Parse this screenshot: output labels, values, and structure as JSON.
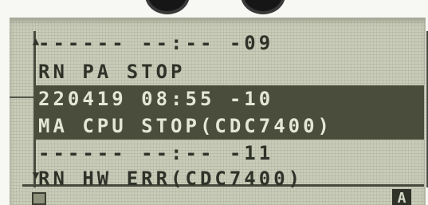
{
  "log": {
    "entries": [
      {
        "line1_date": "------",
        "line1_time": "--:--",
        "line1_code": "-09",
        "message": null
      },
      {
        "line1_date": null,
        "message": "RN PA STOP"
      },
      {
        "line1_date": "220419",
        "line1_time": "08:55",
        "line1_code": "-10",
        "selected": true
      },
      {
        "message": "MA CPU STOP(CDC7400)",
        "selected": true
      },
      {
        "line1_date": "------",
        "line1_time": "--:--",
        "line1_code": "-11"
      },
      {
        "message": "RN HW ERR(CDC7400)"
      }
    ]
  },
  "rows": [
    "------ --:-- -09",
    "RN PA STOP",
    "220419 08:55 -10",
    "MA CPU STOP(CDC7400)",
    "------ --:-- -11",
    "RN HW ERR(CDC7400)"
  ],
  "softkeys": {
    "right_label": "A"
  },
  "icons": {
    "scroll_up": "scroll-up-arrow-icon",
    "scroll_down": "scroll-down-arrow-icon"
  },
  "colors": {
    "lcd_background": "#c9ccb8",
    "pixel_dark": "#2f3228",
    "selection": "#4b4d3c"
  }
}
